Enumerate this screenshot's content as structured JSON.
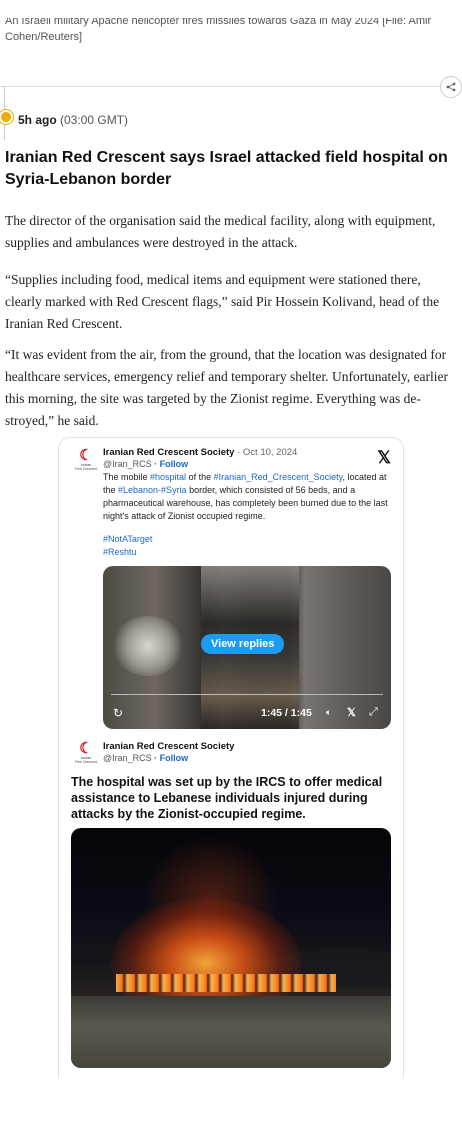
{
  "caption": {
    "line1": "An Israeli military Apache helicopter fires missiles towards Gaza in May 2024 [File: Amir",
    "line2": "Cohen/Reuters]"
  },
  "live_entry": {
    "time_ago": "5h ago",
    "time_gmt": "(03:00 GMT)",
    "headline": "Iranian Red Crescent says Israel attacked field hospital on Syria-Lebanon border",
    "paragraphs": [
      "The director of the organisation said the medical facility, along with equipment, supplies and ambulances were destroyed in the attack.",
      "“Supplies including food, medical items and equipment were stationed there, clearly marked with Red Crescent flags,” said Pir Hossein Kolivand, head of the Iranian Red Crescent.",
      "“It was evident from the air, from the ground, that the location was designated for healthcare services, emergency relief and temporary shelter. Unfortunately, earlier this morning, the site was targeted by the Zionist regime. Everything was de-stroyed,” he said."
    ]
  },
  "tweet": {
    "account_name": "Iranian Red Crescent Society",
    "date": "· Oct 10, 2024",
    "handle": "@Iran_RCS",
    "follow": "· Follow",
    "x_logo": "𝕏",
    "body": {
      "t1": "The mobile ",
      "l1": "#hospital",
      "t2": " of the ",
      "l2": "#Iranian_Red_Crescent_Society",
      "t3": ", located at the ",
      "l3": "#Lebanon-#Syria",
      "t4": " border, which consisted of 56 beds, and a pharmaceutical warehouse, has completely been burned due to the last night's attack of Zionist occupied regime."
    },
    "hashtags": [
      "#NotATarget",
      "#Reshtu"
    ],
    "video": {
      "view_replies": "View replies",
      "time": "1:45 / 1:45"
    }
  },
  "tweet2": {
    "account_name": "Iranian Red Crescent Society",
    "handle": "@Iran_RCS",
    "follow": "· Follow",
    "text": "The hospital was set up by the IRCS to offer medical assistance to Lebanese individuals injured during attacks by the Zionist-occupied regime."
  },
  "logo": {
    "crescent": "☾",
    "tiny_line1": "Iranian",
    "tiny_line2": "Red Crescent"
  },
  "icons": {
    "share": "share-icon",
    "reload": "reload-icon",
    "volume": "volume-icon",
    "expand": "expand-icon"
  },
  "colors": {
    "accent_dot": "#f2a900",
    "link": "#1d68c2",
    "replies_button": "#1d9bf0",
    "crescent_red": "#d8141a"
  }
}
